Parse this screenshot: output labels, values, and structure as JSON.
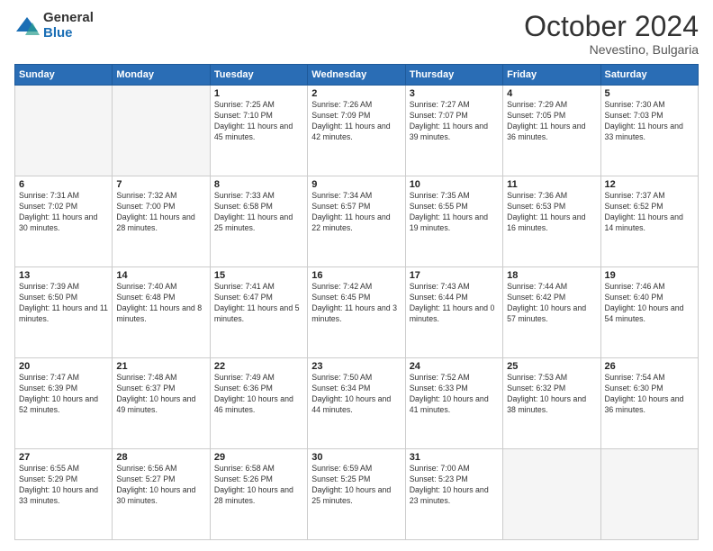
{
  "header": {
    "logo_general": "General",
    "logo_blue": "Blue",
    "month": "October 2024",
    "location": "Nevestino, Bulgaria"
  },
  "days_of_week": [
    "Sunday",
    "Monday",
    "Tuesday",
    "Wednesday",
    "Thursday",
    "Friday",
    "Saturday"
  ],
  "weeks": [
    [
      {
        "day": "",
        "empty": true
      },
      {
        "day": "",
        "empty": true
      },
      {
        "day": "1",
        "sunrise": "Sunrise: 7:25 AM",
        "sunset": "Sunset: 7:10 PM",
        "daylight": "Daylight: 11 hours and 45 minutes."
      },
      {
        "day": "2",
        "sunrise": "Sunrise: 7:26 AM",
        "sunset": "Sunset: 7:09 PM",
        "daylight": "Daylight: 11 hours and 42 minutes."
      },
      {
        "day": "3",
        "sunrise": "Sunrise: 7:27 AM",
        "sunset": "Sunset: 7:07 PM",
        "daylight": "Daylight: 11 hours and 39 minutes."
      },
      {
        "day": "4",
        "sunrise": "Sunrise: 7:29 AM",
        "sunset": "Sunset: 7:05 PM",
        "daylight": "Daylight: 11 hours and 36 minutes."
      },
      {
        "day": "5",
        "sunrise": "Sunrise: 7:30 AM",
        "sunset": "Sunset: 7:03 PM",
        "daylight": "Daylight: 11 hours and 33 minutes."
      }
    ],
    [
      {
        "day": "6",
        "sunrise": "Sunrise: 7:31 AM",
        "sunset": "Sunset: 7:02 PM",
        "daylight": "Daylight: 11 hours and 30 minutes."
      },
      {
        "day": "7",
        "sunrise": "Sunrise: 7:32 AM",
        "sunset": "Sunset: 7:00 PM",
        "daylight": "Daylight: 11 hours and 28 minutes."
      },
      {
        "day": "8",
        "sunrise": "Sunrise: 7:33 AM",
        "sunset": "Sunset: 6:58 PM",
        "daylight": "Daylight: 11 hours and 25 minutes."
      },
      {
        "day": "9",
        "sunrise": "Sunrise: 7:34 AM",
        "sunset": "Sunset: 6:57 PM",
        "daylight": "Daylight: 11 hours and 22 minutes."
      },
      {
        "day": "10",
        "sunrise": "Sunrise: 7:35 AM",
        "sunset": "Sunset: 6:55 PM",
        "daylight": "Daylight: 11 hours and 19 minutes."
      },
      {
        "day": "11",
        "sunrise": "Sunrise: 7:36 AM",
        "sunset": "Sunset: 6:53 PM",
        "daylight": "Daylight: 11 hours and 16 minutes."
      },
      {
        "day": "12",
        "sunrise": "Sunrise: 7:37 AM",
        "sunset": "Sunset: 6:52 PM",
        "daylight": "Daylight: 11 hours and 14 minutes."
      }
    ],
    [
      {
        "day": "13",
        "sunrise": "Sunrise: 7:39 AM",
        "sunset": "Sunset: 6:50 PM",
        "daylight": "Daylight: 11 hours and 11 minutes."
      },
      {
        "day": "14",
        "sunrise": "Sunrise: 7:40 AM",
        "sunset": "Sunset: 6:48 PM",
        "daylight": "Daylight: 11 hours and 8 minutes."
      },
      {
        "day": "15",
        "sunrise": "Sunrise: 7:41 AM",
        "sunset": "Sunset: 6:47 PM",
        "daylight": "Daylight: 11 hours and 5 minutes."
      },
      {
        "day": "16",
        "sunrise": "Sunrise: 7:42 AM",
        "sunset": "Sunset: 6:45 PM",
        "daylight": "Daylight: 11 hours and 3 minutes."
      },
      {
        "day": "17",
        "sunrise": "Sunrise: 7:43 AM",
        "sunset": "Sunset: 6:44 PM",
        "daylight": "Daylight: 11 hours and 0 minutes."
      },
      {
        "day": "18",
        "sunrise": "Sunrise: 7:44 AM",
        "sunset": "Sunset: 6:42 PM",
        "daylight": "Daylight: 10 hours and 57 minutes."
      },
      {
        "day": "19",
        "sunrise": "Sunrise: 7:46 AM",
        "sunset": "Sunset: 6:40 PM",
        "daylight": "Daylight: 10 hours and 54 minutes."
      }
    ],
    [
      {
        "day": "20",
        "sunrise": "Sunrise: 7:47 AM",
        "sunset": "Sunset: 6:39 PM",
        "daylight": "Daylight: 10 hours and 52 minutes."
      },
      {
        "day": "21",
        "sunrise": "Sunrise: 7:48 AM",
        "sunset": "Sunset: 6:37 PM",
        "daylight": "Daylight: 10 hours and 49 minutes."
      },
      {
        "day": "22",
        "sunrise": "Sunrise: 7:49 AM",
        "sunset": "Sunset: 6:36 PM",
        "daylight": "Daylight: 10 hours and 46 minutes."
      },
      {
        "day": "23",
        "sunrise": "Sunrise: 7:50 AM",
        "sunset": "Sunset: 6:34 PM",
        "daylight": "Daylight: 10 hours and 44 minutes."
      },
      {
        "day": "24",
        "sunrise": "Sunrise: 7:52 AM",
        "sunset": "Sunset: 6:33 PM",
        "daylight": "Daylight: 10 hours and 41 minutes."
      },
      {
        "day": "25",
        "sunrise": "Sunrise: 7:53 AM",
        "sunset": "Sunset: 6:32 PM",
        "daylight": "Daylight: 10 hours and 38 minutes."
      },
      {
        "day": "26",
        "sunrise": "Sunrise: 7:54 AM",
        "sunset": "Sunset: 6:30 PM",
        "daylight": "Daylight: 10 hours and 36 minutes."
      }
    ],
    [
      {
        "day": "27",
        "sunrise": "Sunrise: 6:55 AM",
        "sunset": "Sunset: 5:29 PM",
        "daylight": "Daylight: 10 hours and 33 minutes."
      },
      {
        "day": "28",
        "sunrise": "Sunrise: 6:56 AM",
        "sunset": "Sunset: 5:27 PM",
        "daylight": "Daylight: 10 hours and 30 minutes."
      },
      {
        "day": "29",
        "sunrise": "Sunrise: 6:58 AM",
        "sunset": "Sunset: 5:26 PM",
        "daylight": "Daylight: 10 hours and 28 minutes."
      },
      {
        "day": "30",
        "sunrise": "Sunrise: 6:59 AM",
        "sunset": "Sunset: 5:25 PM",
        "daylight": "Daylight: 10 hours and 25 minutes."
      },
      {
        "day": "31",
        "sunrise": "Sunrise: 7:00 AM",
        "sunset": "Sunset: 5:23 PM",
        "daylight": "Daylight: 10 hours and 23 minutes."
      },
      {
        "day": "",
        "empty": true
      },
      {
        "day": "",
        "empty": true
      }
    ]
  ]
}
